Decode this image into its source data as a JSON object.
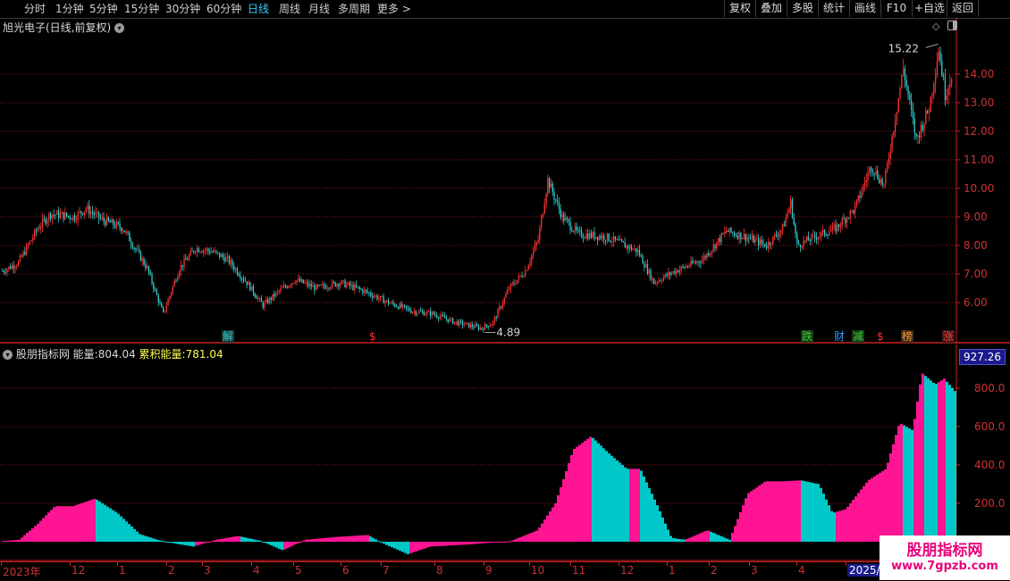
{
  "toolbar": {
    "periods": [
      "分时",
      "1分钟",
      "5分钟",
      "15分钟",
      "30分钟",
      "60分钟",
      "日线",
      "周线",
      "月线",
      "多周期",
      "更多"
    ],
    "active_period": "日线",
    "buttons": [
      "复权",
      "叠加",
      "多股",
      "统计",
      "画线",
      "F10",
      "+自选",
      "返回"
    ]
  },
  "stock": {
    "title": "旭光电子(日线,前复权)",
    "high_label": "15.22",
    "low_label": "4.89"
  },
  "main_chart": {
    "y_ticks": [
      "14.00",
      "13.00",
      "12.00",
      "11.00",
      "10.00",
      "9.00",
      "8.00",
      "7.00",
      "6.00"
    ],
    "events": [
      {
        "label": "解",
        "color": "#33cccc"
      },
      {
        "label": "$",
        "color": "#ff3333"
      },
      {
        "label": "跌",
        "color": "#33cc33"
      },
      {
        "label": "财",
        "color": "#3399ff"
      },
      {
        "label": "减",
        "color": "#33cc33"
      },
      {
        "label": "$",
        "color": "#ff3333"
      },
      {
        "label": "榜",
        "color": "#ff9933"
      },
      {
        "label": "涨",
        "color": "#ff3333"
      }
    ]
  },
  "indicator": {
    "name": "股朋指标网",
    "energy_label": "能量:",
    "energy_value": "804.04",
    "cum_label": "累积能量:",
    "cum_value": "781.04",
    "y_ticks": [
      "800.0",
      "600.0",
      "400.0",
      "200.0"
    ],
    "current_value": "927.26"
  },
  "time_axis": [
    "2023年",
    "12",
    "1",
    "2",
    "3",
    "4",
    "5",
    "6",
    "7",
    "8",
    "9",
    "10",
    "11",
    "12",
    "1",
    "2",
    "3",
    "4",
    "2025/0"
  ],
  "watermark": {
    "line1": "股朋指标网",
    "line2": "www.7gpzb.com"
  },
  "colors": {
    "up": "#ff3333",
    "down": "#33cccc",
    "energy_pink": "#ff1493",
    "energy_cyan": "#00c8c8",
    "grid": "#8b1a1a",
    "axis": "#cc2222"
  },
  "icons": [
    "chevron-down-icon",
    "diamond-icon",
    "panel-toggle-icon",
    "chevron-right-icon"
  ]
}
